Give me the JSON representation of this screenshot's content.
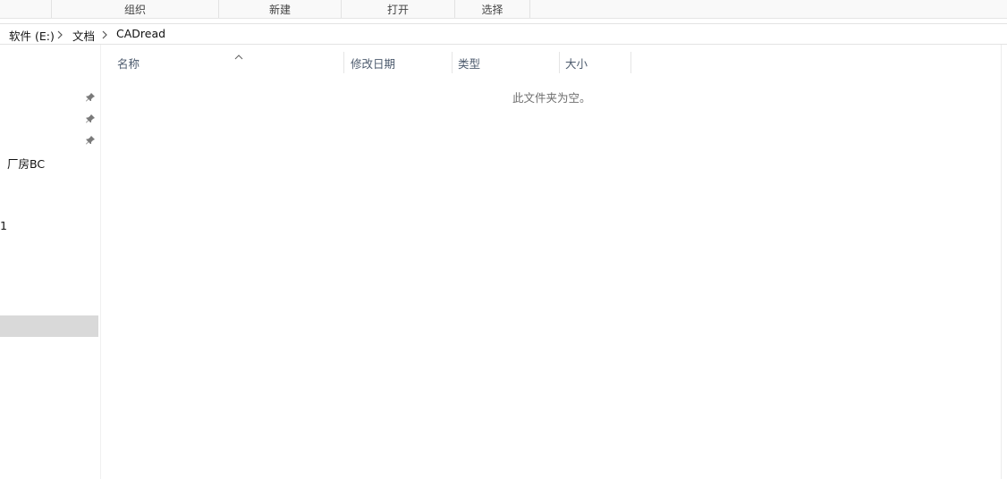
{
  "ribbon": {
    "groups": [
      "组织",
      "新建",
      "打开",
      "选择"
    ]
  },
  "address": {
    "crumbs": [
      "软件 (E:)",
      "文档",
      "CADread"
    ]
  },
  "nav": {
    "items": [
      "厂房BC",
      "1"
    ]
  },
  "columns": {
    "name": "名称",
    "modified": "修改日期",
    "type": "类型",
    "size": "大小"
  },
  "content": {
    "empty_message": "此文件夹为空。"
  },
  "icons": {
    "pin": "pin-icon",
    "separator": "chevron-right-icon",
    "sort": "sort-ascending-icon"
  }
}
